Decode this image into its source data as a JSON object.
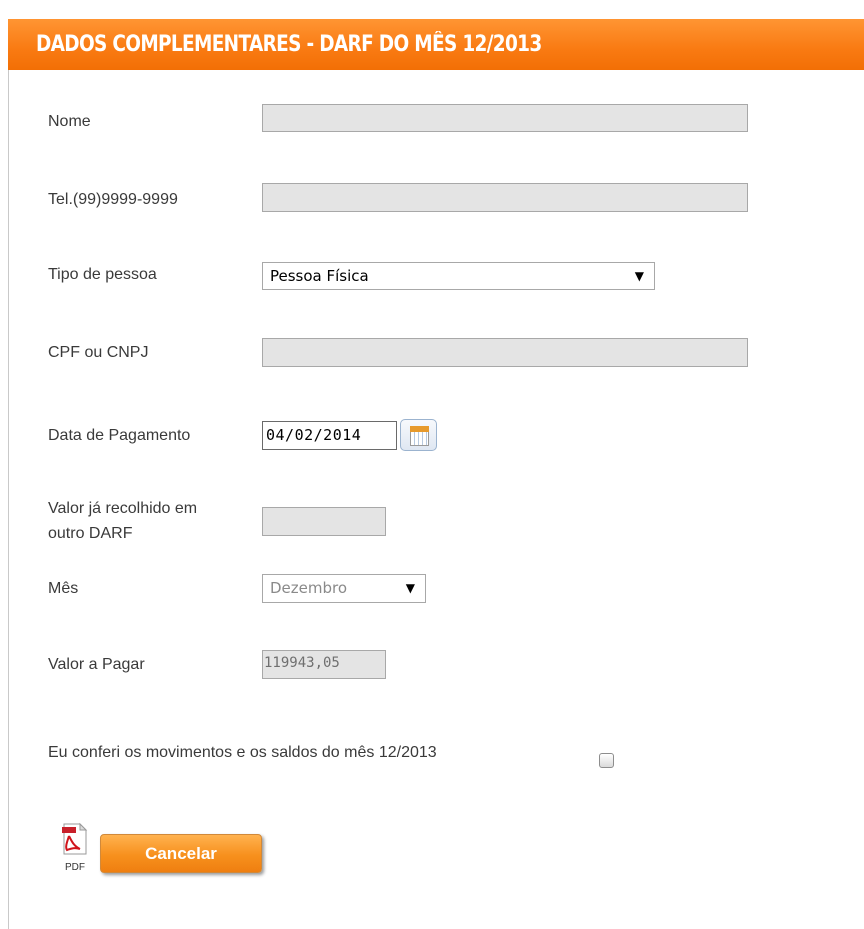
{
  "header": {
    "title": "DADOS COMPLEMENTARES - DARF DO MÊS 12/2013"
  },
  "form": {
    "nome": {
      "label": "Nome",
      "value": ""
    },
    "telefone": {
      "label": "Tel.(99)9999-9999",
      "value": ""
    },
    "tipo_pessoa": {
      "label": "Tipo de pessoa",
      "selected": "Pessoa Física"
    },
    "cpf_cnpj": {
      "label": "CPF ou CNPJ",
      "value": ""
    },
    "data_pagamento": {
      "label": "Data de Pagamento",
      "value": "04/02/2014"
    },
    "valor_recolhido": {
      "label_line1": "Valor já recolhido em",
      "label_line2": "outro DARF",
      "value": ""
    },
    "mes": {
      "label": "Mês",
      "selected": "Dezembro"
    },
    "valor_pagar": {
      "label": "Valor a Pagar",
      "value": "119943,05"
    },
    "confirm": {
      "label": "Eu conferi os movimentos e os saldos do mês 12/2013",
      "checked": false
    }
  },
  "actions": {
    "pdf_label": "PDF",
    "cancel_label": "Cancelar"
  },
  "icons": {
    "dropdown": "▼",
    "calendar": "calendar-icon",
    "pdf": "pdf-icon"
  },
  "colors": {
    "header": "#f97a12",
    "button": "#f7901d"
  }
}
